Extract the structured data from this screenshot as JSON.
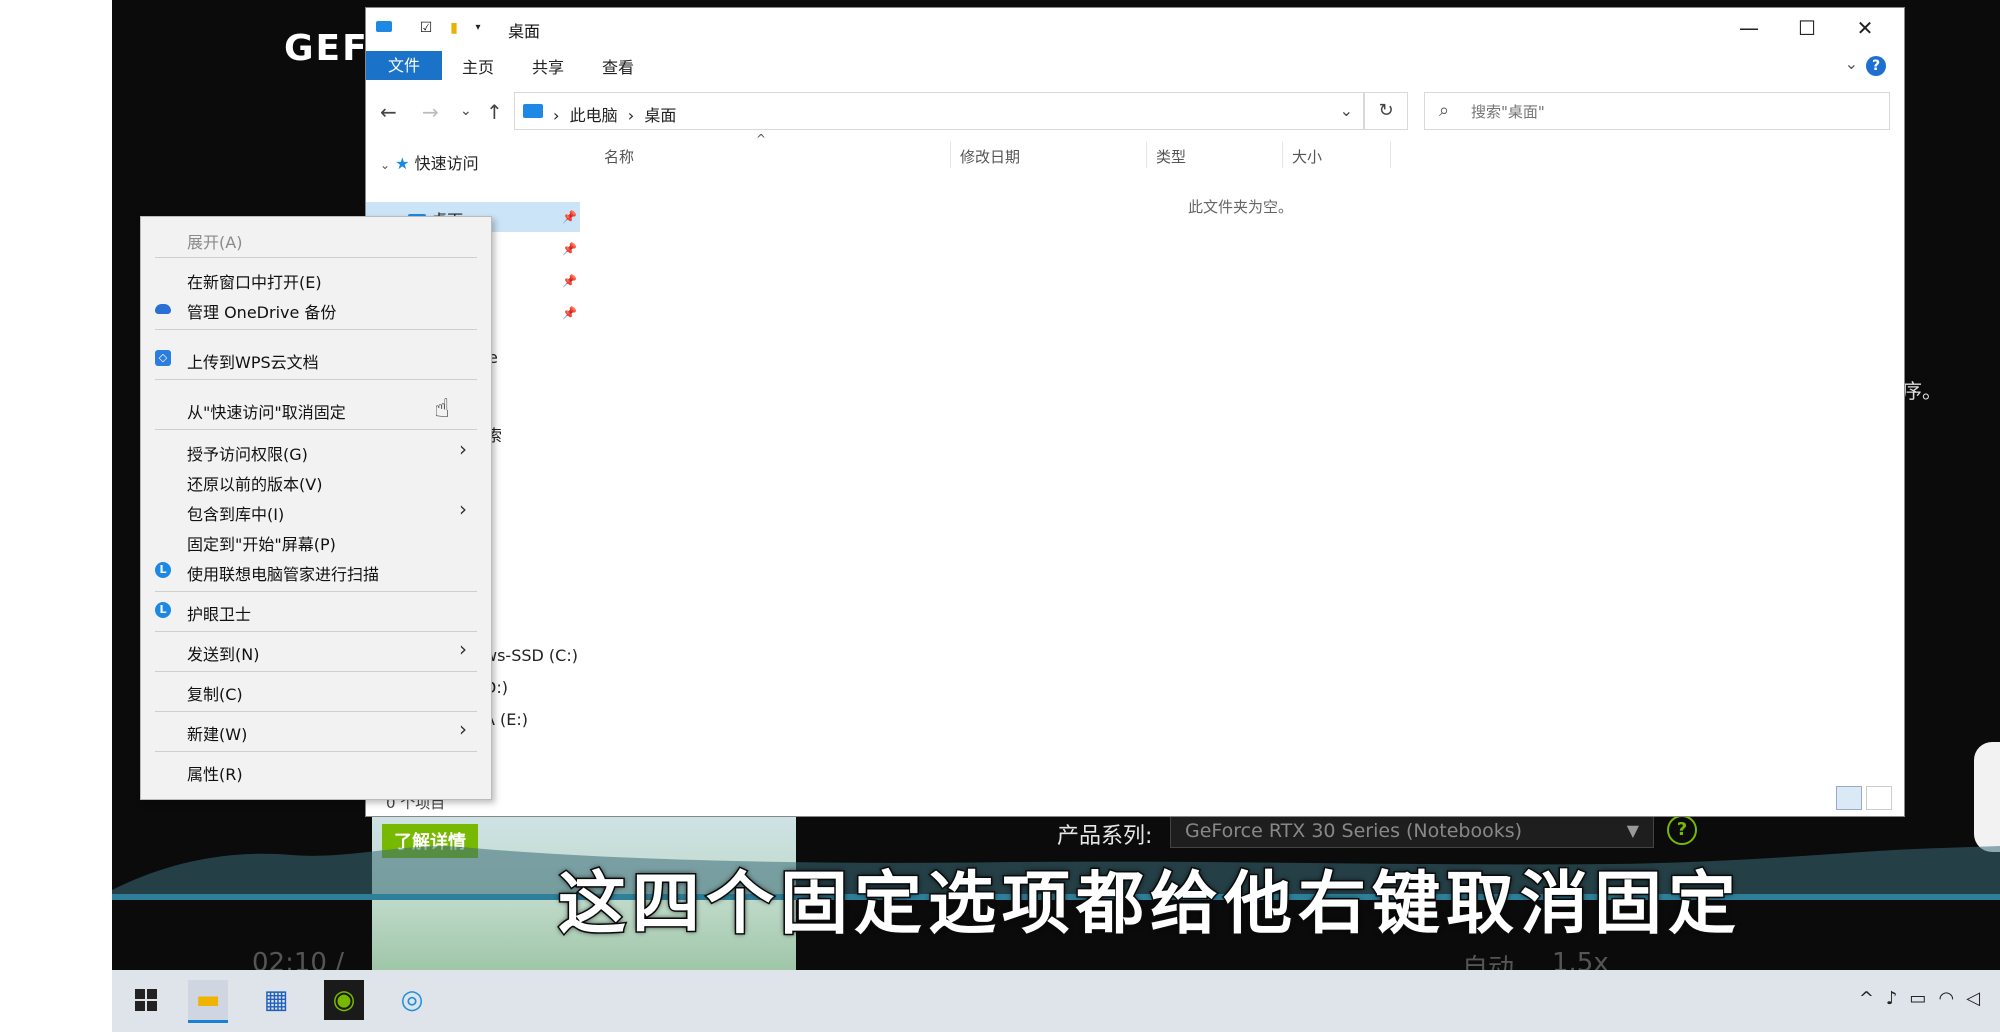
{
  "video": {
    "brand": "GEF",
    "right_edge_char": "序。",
    "subtitle": "这四个固定选项都给他右键取消固定",
    "promo_button": "了解详情",
    "product_label": "产品系列:",
    "product_select": "GeForce RTX 30 Series (Notebooks)",
    "player_time": "02:10 /",
    "player_auto": "自动",
    "player_speed": "1.5x"
  },
  "explorer": {
    "title": "桌面",
    "ribbon_tabs": [
      "文件",
      "主页",
      "共享",
      "查看"
    ],
    "address_crumbs": [
      "此电脑",
      "桌面"
    ],
    "search_placeholder": "搜索\"桌面\"",
    "columns": [
      "名称",
      "修改日期",
      "类型",
      "大小"
    ],
    "empty_text": "此文件夹为空。",
    "status_count": "0 个项目",
    "nav": {
      "quick_access": "快速访问",
      "desktop": "桌面",
      "partial_onedrive": "e",
      "partial_search": "索",
      "drive_c": "ws-SSD (C:)",
      "drive_d": "D:)",
      "drive_e": "A (E:)"
    }
  },
  "context_menu": {
    "items": [
      {
        "label": "展开(A)",
        "disabled": true
      },
      {
        "label": "在新窗口中打开(E)"
      },
      {
        "label": "管理 OneDrive 备份",
        "icon": "onedrive-icon"
      },
      {
        "label": "上传到WPS云文档",
        "icon": "wps-cloud-icon"
      },
      {
        "label": "从\"快速访问\"取消固定"
      },
      {
        "label": "授予访问权限(G)",
        "submenu": true
      },
      {
        "label": "还原以前的版本(V)"
      },
      {
        "label": "包含到库中(I)",
        "submenu": true
      },
      {
        "label": "固定到\"开始\"屏幕(P)"
      },
      {
        "label": "使用联想电脑管家进行扫描",
        "icon": "lenovo-icon"
      },
      {
        "label": "护眼卫士",
        "icon": "lenovo-icon"
      },
      {
        "label": "发送到(N)",
        "submenu": true
      },
      {
        "label": "复制(C)"
      },
      {
        "label": "新建(W)",
        "submenu": true
      },
      {
        "label": "属性(R)"
      }
    ]
  },
  "colors": {
    "accent": "#1a73c8",
    "nvidia_green": "#76b900",
    "selection": "#cce4f7"
  }
}
